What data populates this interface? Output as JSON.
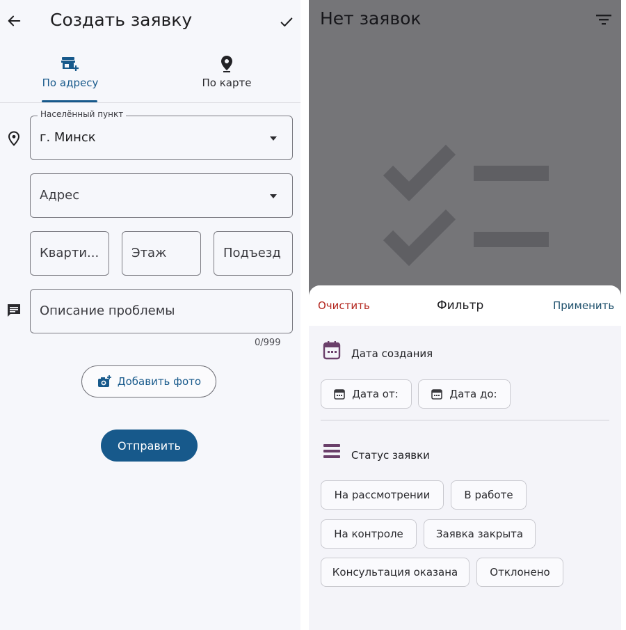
{
  "create_screen": {
    "title": "Создать заявку",
    "tabs": [
      {
        "label": "По адресу",
        "icon": "store-plus-icon"
      },
      {
        "label": "По карте",
        "icon": "map-pin-icon"
      }
    ],
    "locality": {
      "label": "Населённый пункт",
      "value": "г. Минск"
    },
    "address": {
      "placeholder": "Адрес"
    },
    "apartment": {
      "placeholder": "Кварти..."
    },
    "floor": {
      "placeholder": "Этаж"
    },
    "entrance": {
      "placeholder": "Подъезд"
    },
    "description": {
      "placeholder": "Описание проблемы",
      "counter": "0/999"
    },
    "add_photo_label": "Добавить фото",
    "submit_label": "Отправить"
  },
  "list_screen": {
    "empty_title": "Нет заявок"
  },
  "filter_sheet": {
    "clear_label": "Очистить",
    "title": "Фильтр",
    "apply_label": "Применить",
    "date_section": {
      "title": "Дата создания",
      "from_label": "Дата от:",
      "to_label": "Дата до:"
    },
    "status_section": {
      "title": "Статус заявки",
      "chips": [
        "На рассмотрении",
        "В работе",
        "На контроле",
        "Заявка закрыта",
        "Консультация оказана",
        "Отклонено"
      ]
    }
  },
  "colors": {
    "primary": "#17598b",
    "clear_red": "#b3261e",
    "apply_teal": "#1d4f6b",
    "section_icon": "#6a3f6a",
    "overlay": "#757578"
  }
}
